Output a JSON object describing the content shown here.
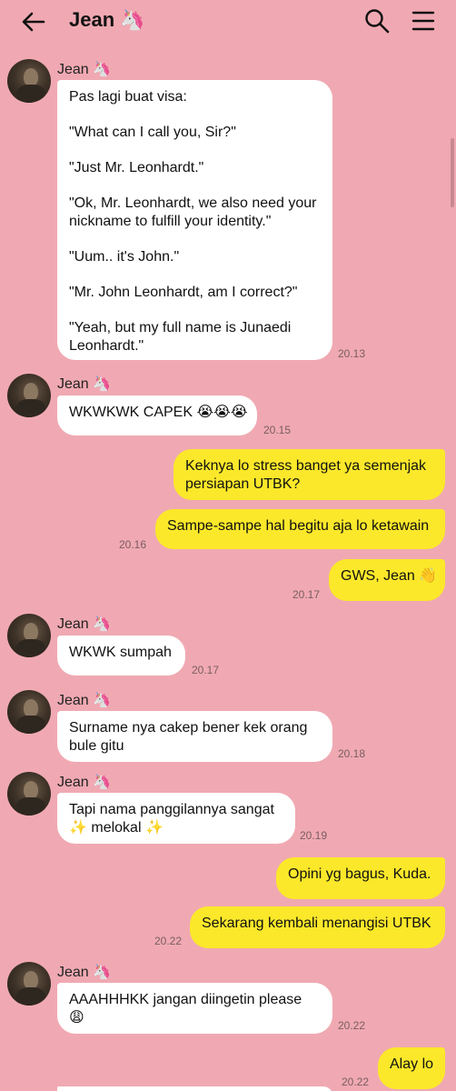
{
  "header": {
    "title": "Jean 🦄"
  },
  "messages": [
    {
      "sender": "Jean 🦄",
      "lines": [
        "Pas lagi buat visa:",
        "",
        "\"What can I call you, Sir?\"",
        "",
        "\"Just Mr. Leonhardt.\"",
        "",
        "\"Ok, Mr. Leonhardt, we also need your",
        "nickname to fulfill your identity.\"",
        "",
        "\"Uum.. it's John.\"",
        "",
        "\"Mr. John Leonhardt, am I correct?\"",
        "",
        "\"Yeah, but my full name is Junaedi",
        "Leonhardt.\""
      ],
      "time": "20.13"
    },
    {
      "sender": "Jean 🦄",
      "lines": [
        "WKWKWK CAPEK 😭😭😭"
      ],
      "time": "20.15"
    },
    {
      "lines": [
        "Keknya lo stress banget ya semenjak",
        "persiapan UTBK?"
      ]
    },
    {
      "lines": [
        "Sampe-sampe hal begitu aja lo ketawain"
      ],
      "time": "20.16"
    },
    {
      "lines": [
        "GWS, Jean 👋"
      ],
      "time": "20.17"
    },
    {
      "sender": "Jean 🦄",
      "lines": [
        "WKWK sumpah"
      ],
      "time": "20.17"
    },
    {
      "sender": "Jean 🦄",
      "lines": [
        "Surname nya cakep bener kek orang",
        "bule gitu"
      ],
      "time": "20.18"
    },
    {
      "sender": "Jean 🦄",
      "lines": [
        "Tapi nama panggilannya sangat",
        "✨ melokal ✨"
      ],
      "time": "20.19"
    },
    {
      "lines": [
        "Opini yg bagus, Kuda."
      ]
    },
    {
      "lines": [
        "Sekarang kembali menangisi UTBK"
      ],
      "time": "20.22"
    },
    {
      "sender": "Jean 🦄",
      "lines": [
        "AAAHHHKK jangan diingetin please",
        "😩"
      ],
      "time": "20.22"
    },
    {
      "lines": [
        "Alay lo"
      ],
      "time": "20.22"
    }
  ]
}
